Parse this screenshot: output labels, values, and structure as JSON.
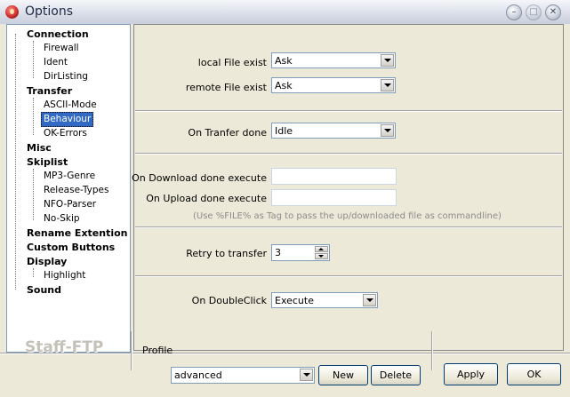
{
  "window": {
    "title": "Options"
  },
  "tree": {
    "items": [
      {
        "label": "Connection",
        "level": 0
      },
      {
        "label": "Firewall",
        "level": 1
      },
      {
        "label": "Ident",
        "level": 1
      },
      {
        "label": "DirListing",
        "level": 1
      },
      {
        "label": "Transfer",
        "level": 0
      },
      {
        "label": "ASCII-Mode",
        "level": 1
      },
      {
        "label": "Behaviour",
        "level": 1,
        "selected": true
      },
      {
        "label": "OK-Errors",
        "level": 1
      },
      {
        "label": "Misc",
        "level": 0
      },
      {
        "label": "Skiplist",
        "level": 0
      },
      {
        "label": "MP3-Genre",
        "level": 1
      },
      {
        "label": "Release-Types",
        "level": 1
      },
      {
        "label": "NFO-Parser",
        "level": 1
      },
      {
        "label": "No-Skip",
        "level": 1
      },
      {
        "label": "Rename Extention",
        "level": 0
      },
      {
        "label": "Custom Buttons",
        "level": 0
      },
      {
        "label": "Display",
        "level": 0
      },
      {
        "label": "Highlight",
        "level": 1
      },
      {
        "label": "Sound",
        "level": 0
      }
    ]
  },
  "behaviour": {
    "local_file_exist_label": "local File exist",
    "local_file_exist_value": "Ask",
    "remote_file_exist_label": "remote File exist",
    "remote_file_exist_value": "Ask",
    "on_transfer_done_label": "On Tranfer done",
    "on_transfer_done_value": "Idle",
    "on_download_done_label": "On Download done execute",
    "on_download_done_value": "",
    "on_upload_done_label": "On Upload done execute",
    "on_upload_done_value": "",
    "hint": "(Use %FILE% as Tag to pass the up/downloaded file as commandline)",
    "retry_label": "Retry to transfer",
    "retry_value": "3",
    "on_doubleclick_label": "On DoubleClick",
    "on_doubleclick_value": "Execute"
  },
  "footer": {
    "logo": "Staff-FTP",
    "profile_label": "Profile",
    "profile_value": "advanced",
    "new_label": "New",
    "delete_label": "Delete",
    "apply_label": "Apply",
    "ok_label": "OK"
  }
}
